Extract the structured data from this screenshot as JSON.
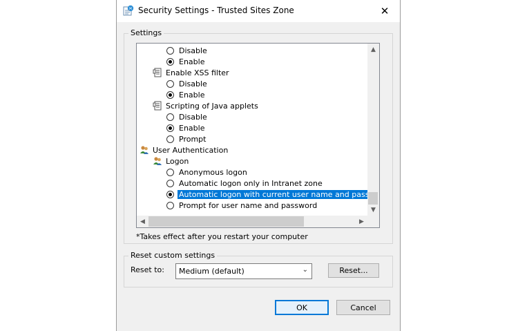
{
  "window": {
    "title": "Security Settings - Trusted Sites Zone",
    "close_glyph": "✕",
    "icon": "settings-page-icon"
  },
  "settings_group": {
    "label": "Settings"
  },
  "tree_rows": [
    {
      "kind": "radio",
      "label": "Disable",
      "checked": false,
      "selected": false
    },
    {
      "kind": "radio",
      "label": "Enable",
      "checked": true,
      "selected": false
    },
    {
      "kind": "setting",
      "label": "Enable XSS filter",
      "icon": "setting-doc-icon"
    },
    {
      "kind": "radio",
      "label": "Disable",
      "checked": false,
      "selected": false
    },
    {
      "kind": "radio",
      "label": "Enable",
      "checked": true,
      "selected": false
    },
    {
      "kind": "setting",
      "label": "Scripting of Java applets",
      "icon": "setting-doc-icon"
    },
    {
      "kind": "radio",
      "label": "Disable",
      "checked": false,
      "selected": false
    },
    {
      "kind": "radio",
      "label": "Enable",
      "checked": true,
      "selected": false
    },
    {
      "kind": "radio",
      "label": "Prompt",
      "checked": false,
      "selected": false
    },
    {
      "kind": "category",
      "label": "User Authentication",
      "icon": "users-icon"
    },
    {
      "kind": "setting",
      "label": "Logon",
      "icon": "users-icon"
    },
    {
      "kind": "radio",
      "label": "Anonymous logon",
      "checked": false,
      "selected": false
    },
    {
      "kind": "radio",
      "label": "Automatic logon only in Intranet zone",
      "checked": false,
      "selected": false
    },
    {
      "kind": "radio",
      "label": "Automatic logon with current user name and password",
      "checked": true,
      "selected": true
    },
    {
      "kind": "radio",
      "label": "Prompt for user name and password",
      "checked": false,
      "selected": false
    }
  ],
  "scroll": {
    "up": "▲",
    "down": "▼",
    "left": "◀",
    "right": "▶"
  },
  "note": "*Takes effect after you restart your computer",
  "reset_group": {
    "label": "Reset custom settings",
    "reset_to_label": "Reset to:",
    "select_value": "Medium (default)",
    "select_arrow": "⌄",
    "reset_button": "Reset..."
  },
  "buttons": {
    "ok": "OK",
    "cancel": "Cancel"
  },
  "colors": {
    "selection": "#0078d7",
    "default_button_border": "#0078d7",
    "dialog_bg": "#f0f0f0"
  }
}
